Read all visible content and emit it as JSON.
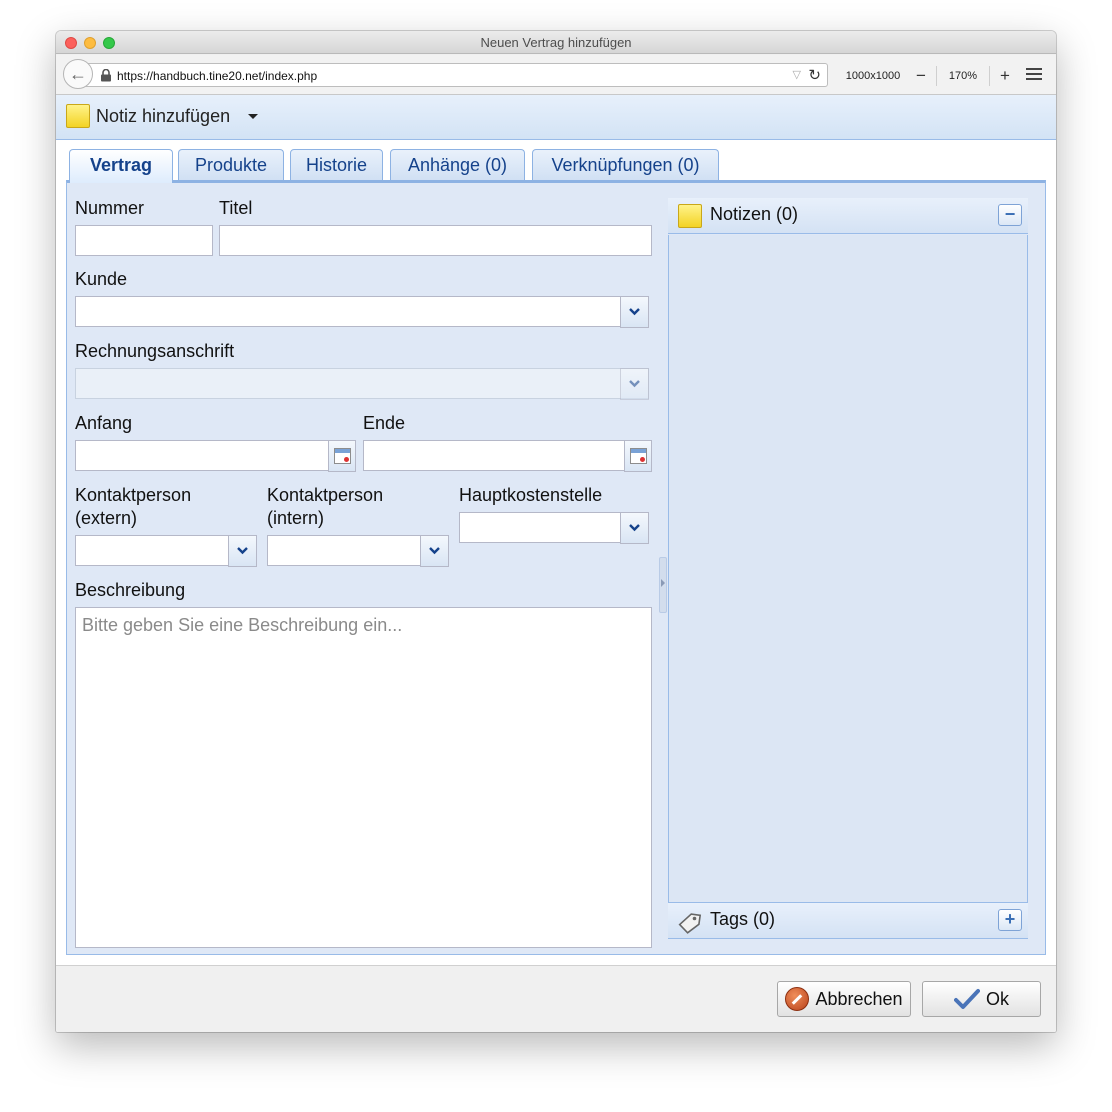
{
  "window": {
    "title": "Neuen Vertrag hinzufügen"
  },
  "browser": {
    "url": "https://handbuch.tine20.net/index.php",
    "viewport_size": "1000x1000",
    "zoom_minus": "−",
    "zoom_level": "170%",
    "zoom_plus": "+"
  },
  "toolbar": {
    "add_note_label": "Notiz hinzufügen"
  },
  "tabs": [
    {
      "label": "Vertrag"
    },
    {
      "label": "Produkte"
    },
    {
      "label": "Historie"
    },
    {
      "label": "Anhänge (0)"
    },
    {
      "label": "Verknüpfungen (0)"
    }
  ],
  "form": {
    "nummer_label": "Nummer",
    "nummer_value": "",
    "titel_label": "Titel",
    "titel_value": "",
    "kunde_label": "Kunde",
    "kunde_value": "",
    "rechnungsanschrift_label": "Rechnungsanschrift",
    "rechnungsanschrift_value": "",
    "anfang_label": "Anfang",
    "anfang_value": "",
    "ende_label": "Ende",
    "ende_value": "",
    "kontakt_extern_label_1": "Kontaktperson",
    "kontakt_extern_label_2": "(extern)",
    "kontakt_intern_label_1": "Kontaktperson",
    "kontakt_intern_label_2": "(intern)",
    "hauptkostenstelle_label": "Hauptkostenstelle",
    "beschreibung_label": "Beschreibung",
    "beschreibung_placeholder": "Bitte geben Sie eine Beschreibung ein..."
  },
  "side_panel": {
    "notes_title": "Notizen (0)",
    "notes_toggle": "−",
    "tags_title": "Tags (0)",
    "tags_toggle": "+"
  },
  "footer": {
    "cancel_label": "Abbrechen",
    "ok_label": "Ok"
  },
  "colors": {
    "tab_text": "#15428b",
    "panel_bg": "#dfe8f6",
    "panel_border": "#99bbe8"
  }
}
